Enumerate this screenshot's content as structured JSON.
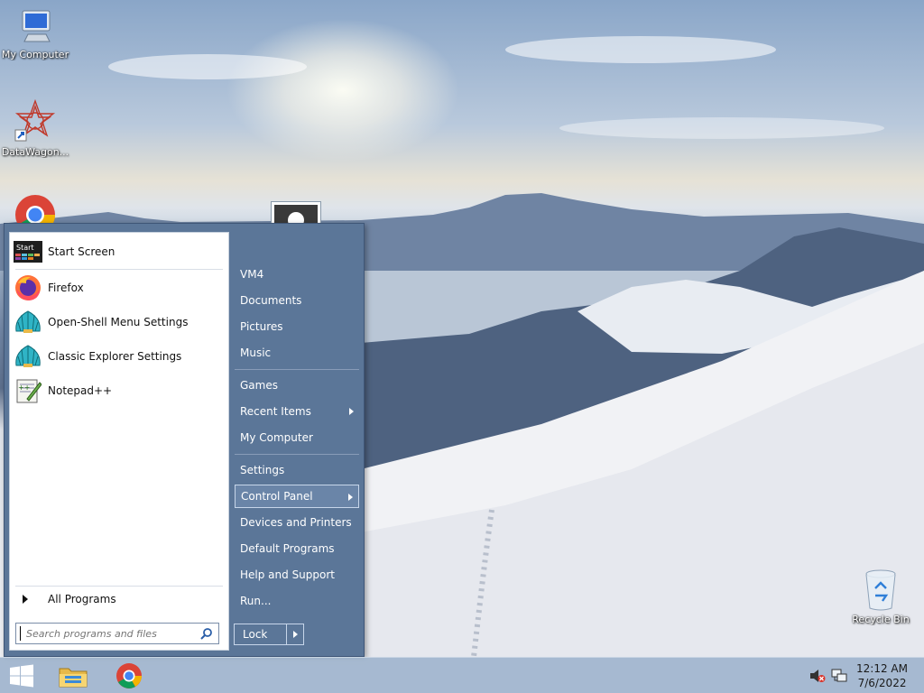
{
  "desktop": {
    "icons": [
      {
        "label": "My Computer",
        "icon": "computer-icon"
      },
      {
        "label": "DataWagon...",
        "icon": "datawagon-icon"
      },
      {
        "label": "",
        "icon": "chrome-icon"
      },
      {
        "label": "Recycle Bin",
        "icon": "recycle-bin-icon"
      }
    ]
  },
  "start_menu": {
    "programs": [
      {
        "label": "Start Screen",
        "icon": "start-screen-icon"
      },
      {
        "label": "Firefox",
        "icon": "firefox-icon"
      },
      {
        "label": "Open-Shell Menu Settings",
        "icon": "shell-icon"
      },
      {
        "label": "Classic Explorer Settings",
        "icon": "shell-icon"
      },
      {
        "label": "Notepad++",
        "icon": "notepad-plus-plus-icon"
      }
    ],
    "start_screen_badge": "Start",
    "all_programs": "All Programs",
    "search_placeholder": "Search programs and files",
    "right_items": [
      {
        "label": "VM4"
      },
      {
        "label": "Documents"
      },
      {
        "label": "Pictures"
      },
      {
        "label": "Music"
      },
      {
        "label": "Games"
      },
      {
        "label": "Recent Items",
        "submenu": true
      },
      {
        "label": "My Computer"
      },
      {
        "label": "Settings"
      },
      {
        "label": "Control Panel",
        "submenu": true,
        "highlighted": true
      },
      {
        "label": "Devices and Printers"
      },
      {
        "label": "Default Programs"
      },
      {
        "label": "Help and Support"
      },
      {
        "label": "Run..."
      }
    ],
    "lock_label": "Lock",
    "accent_color": "#5b7698"
  },
  "taskbar": {
    "pinned": [
      {
        "icon": "windows-start-icon"
      },
      {
        "icon": "file-explorer-icon"
      },
      {
        "icon": "chrome-icon"
      }
    ],
    "tray": [
      {
        "icon": "speaker-muted-icon"
      },
      {
        "icon": "network-icon"
      }
    ],
    "time": "12:12 AM",
    "date": "7/6/2022"
  }
}
